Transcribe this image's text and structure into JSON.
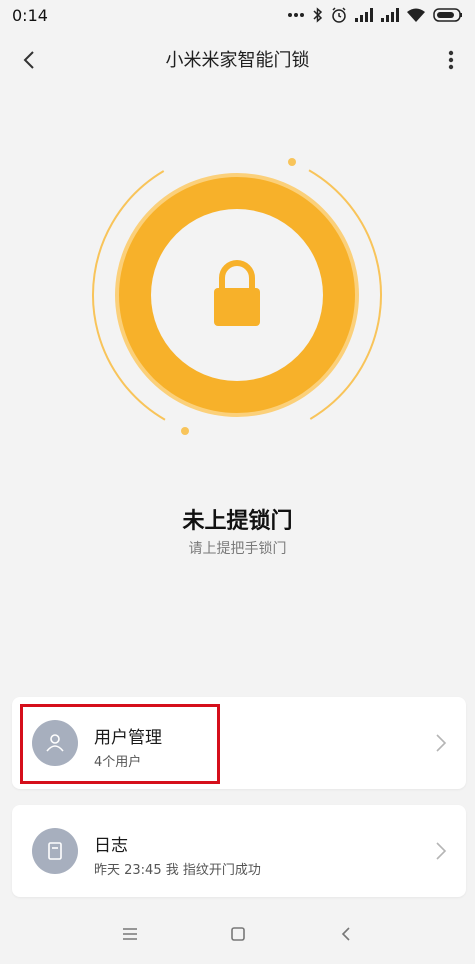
{
  "statusbar": {
    "time": "0:14",
    "icons": [
      "more-dots-icon",
      "bluetooth-icon",
      "alarm-icon",
      "signal-icon",
      "signal-icon",
      "wifi-icon",
      "battery-icon"
    ]
  },
  "header": {
    "title": "小米米家智能门锁",
    "back_icon": "back-icon",
    "more_icon": "more-vertical-icon"
  },
  "lock": {
    "icon": "lock-icon",
    "status_title": "未上提锁门",
    "status_sub": "请上提把手锁门",
    "accent": "#f7b12a",
    "accent_light": "#fbd07a"
  },
  "cards": [
    {
      "label": "用户管理",
      "sub": "4个用户",
      "icon": "user-icon"
    },
    {
      "label": "日志",
      "sub": "昨天 23:45 我 指纹开门成功",
      "icon": "log-icon"
    }
  ],
  "highlight_color": "#d50f1b",
  "navbar": {
    "icons": [
      "menu-icon",
      "home-icon",
      "back-nav-icon"
    ]
  }
}
